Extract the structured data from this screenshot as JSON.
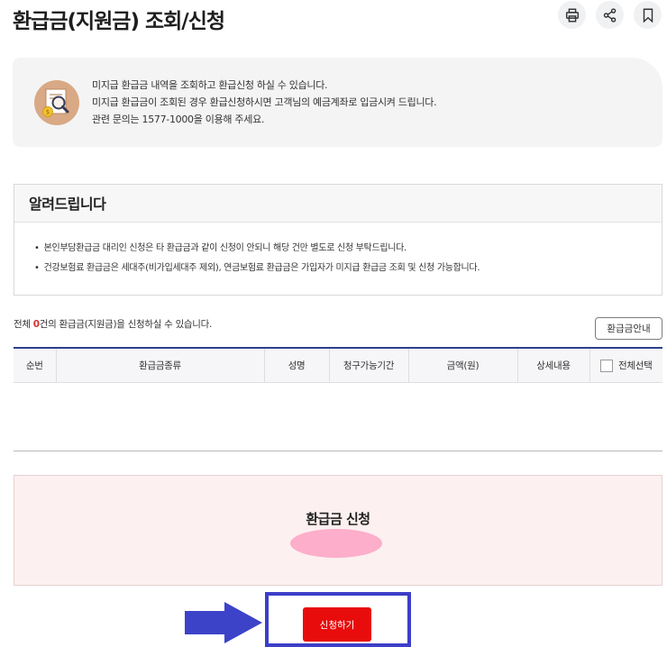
{
  "page": {
    "title": "환급금(지원금) 조회/신청"
  },
  "toolbar": {
    "icons": [
      "print-icon",
      "share-icon",
      "bookmark-icon"
    ]
  },
  "intro": {
    "lines": [
      "미지급 환급금 내역을 조회하고 환급신청 하실 수 있습니다.",
      "미지급 환급금이 조회된 경우 환급신청하시면 고객님의 예금계좌로 입금시켜 드립니다.",
      "관련 문의는 1577-1000을 이용해 주세요."
    ]
  },
  "notice": {
    "title": "알려드립니다",
    "items": [
      "본인부담환급금 대리인 신청은 타 환급금과 같이 신청이 안되니 해당 건만 별도로 신청 부탁드립니다.",
      "건강보험료 환급금은 세대주(비가입세대주 제외), 연금보험료 환급금은 가입자가 미지급 환급금 조회 및 신청 가능합니다."
    ]
  },
  "summary": {
    "prefix": "전체 ",
    "count": "0",
    "suffix": "건의 환급금(지원금)을 신청하실 수 있습니다."
  },
  "guide_button": "환급금안내",
  "table": {
    "columns": [
      "순번",
      "환급금종류",
      "성명",
      "청구가능기간",
      "금액(원)",
      "상세내용",
      "전체선택"
    ]
  },
  "apply": {
    "title": "환급금 신청",
    "button": "신청하기"
  },
  "colors": {
    "accent_navy": "#2e3f8a",
    "apply_red": "#e80c0c",
    "highlight_blue": "#3c3ec8",
    "count_red": "#d23232"
  }
}
